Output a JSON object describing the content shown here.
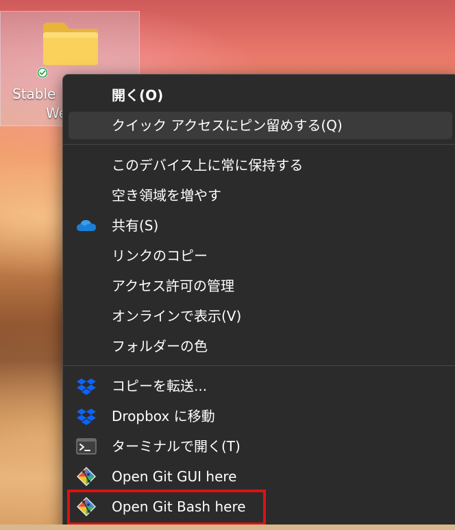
{
  "desktop": {
    "icon": {
      "label_line1": "Stable",
      "label_line2": "We",
      "folder_icon": "folder-icon",
      "status_icon": "sync-check-icon",
      "colors": {
        "folder": "#f7c948",
        "status": "#2e9d4f"
      }
    }
  },
  "context_menu": {
    "groups": [
      {
        "items": [
          {
            "label": "開く(O)",
            "icon": null,
            "bold": true
          },
          {
            "label": "クイック アクセスにピン留めする(Q)",
            "icon": null,
            "hovered": true
          }
        ]
      },
      {
        "items": [
          {
            "label": "このデバイス上に常に保持する",
            "icon": null
          },
          {
            "label": "空き領域を増やす",
            "icon": null
          },
          {
            "label": "共有(S)",
            "icon": "onedrive-cloud-icon"
          },
          {
            "label": "リンクのコピー",
            "icon": null
          },
          {
            "label": "アクセス許可の管理",
            "icon": null
          },
          {
            "label": "オンラインで表示(V)",
            "icon": null
          },
          {
            "label": "フォルダーの色",
            "icon": null
          }
        ]
      },
      {
        "items": [
          {
            "label": "コピーを転送...",
            "icon": "dropbox-icon"
          },
          {
            "label": "Dropbox に移動",
            "icon": "dropbox-icon"
          },
          {
            "label": "ターミナルで開く(T)",
            "icon": "terminal-icon"
          },
          {
            "label": "Open Git GUI here",
            "icon": "git-gui-icon"
          },
          {
            "label": "Open Git Bash here",
            "icon": "git-bash-icon",
            "highlighted": true
          }
        ]
      }
    ],
    "colors": {
      "background": "#2b2b2b",
      "hover": "#3b3b3b",
      "text": "#ffffff",
      "onedrive": "#1a7fd6",
      "dropbox": "#0b64ff",
      "highlight_border": "#e01010"
    }
  }
}
